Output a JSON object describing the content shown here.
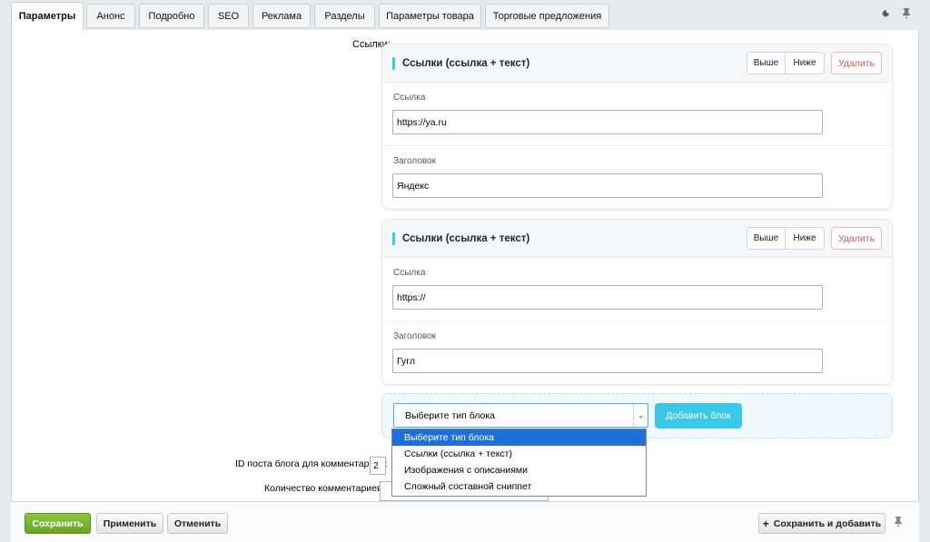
{
  "tabs": [
    "Параметры",
    "Анонс",
    "Подробно",
    "SEO",
    "Реклама",
    "Разделы",
    "Параметры товара",
    "Торговые предложения"
  ],
  "links_label": "Ссылки:",
  "cards": [
    {
      "title": "Ссылки (ссылка + текст)",
      "up": "Выше",
      "down": "Ниже",
      "delete": "Удалить",
      "link_label": "Ссылка",
      "link_value": "https://ya.ru",
      "heading_label": "Заголовок",
      "heading_value": "Яндекс"
    },
    {
      "title": "Ссылки (ссылка + текст)",
      "up": "Выше",
      "down": "Ниже",
      "delete": "Удалить",
      "link_label": "Ссылка",
      "link_value": "https://",
      "heading_label": "Заголовок",
      "heading_value": "Гугл"
    }
  ],
  "block_select": {
    "selected": "Выберите тип блока",
    "add_button": "Добавить блок",
    "options": [
      "Выберите тип блока",
      "Ссылки (ссылка + текст)",
      "Изображения с описаниями",
      "Сложный составной сниппет"
    ]
  },
  "blog_post_id_label": "ID поста блога для комментариев:",
  "blog_post_id_value": "2",
  "comments_count_label": "Количество комментариев:",
  "footer": {
    "save": "Сохранить",
    "apply": "Применить",
    "cancel": "Отменить",
    "save_and_add": "Сохранить и добавить"
  },
  "icons": {
    "settings": "gear-icon",
    "pin": "pin-icon",
    "plus": "plus-icon",
    "dropdown": "chevron-down-icon"
  },
  "colors": {
    "accent": "#3bc8e7",
    "save_green": "#6aa323",
    "delete_red": "#d2594d",
    "selected_option": "#1e6fd9"
  }
}
